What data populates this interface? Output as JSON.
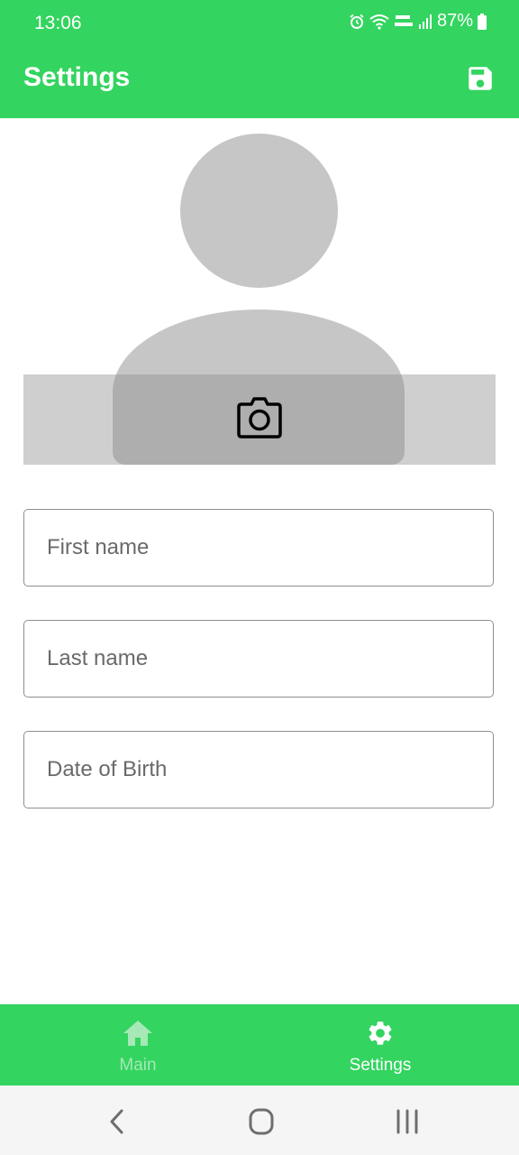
{
  "status_bar": {
    "time": "13:06",
    "battery": "87%",
    "icons": [
      "alarm-icon",
      "wifi-icon",
      "volte-lte2-icon",
      "signal-icon",
      "battery-icon"
    ]
  },
  "app_bar": {
    "title": "Settings",
    "save_icon": "save-icon"
  },
  "avatar": {
    "placeholder_icon": "person-icon",
    "camera_icon": "camera-icon"
  },
  "form": {
    "first_name": {
      "placeholder": "First name",
      "value": ""
    },
    "last_name": {
      "placeholder": "Last name",
      "value": ""
    },
    "date_of_birth": {
      "placeholder": "Date of Birth",
      "value": ""
    }
  },
  "bottom_nav": {
    "items": [
      {
        "label": "Main",
        "icon": "home-icon",
        "selected": false
      },
      {
        "label": "Settings",
        "icon": "gear-icon",
        "selected": true
      }
    ]
  },
  "system_nav": {
    "buttons": [
      "back-icon",
      "home-circle-icon",
      "recents-icon"
    ]
  },
  "colors": {
    "primary": "#33d45f",
    "placeholder_gray": "#c6c6c6",
    "nav_inactive": "#a6e8b6",
    "on_primary": "#ffffff"
  }
}
